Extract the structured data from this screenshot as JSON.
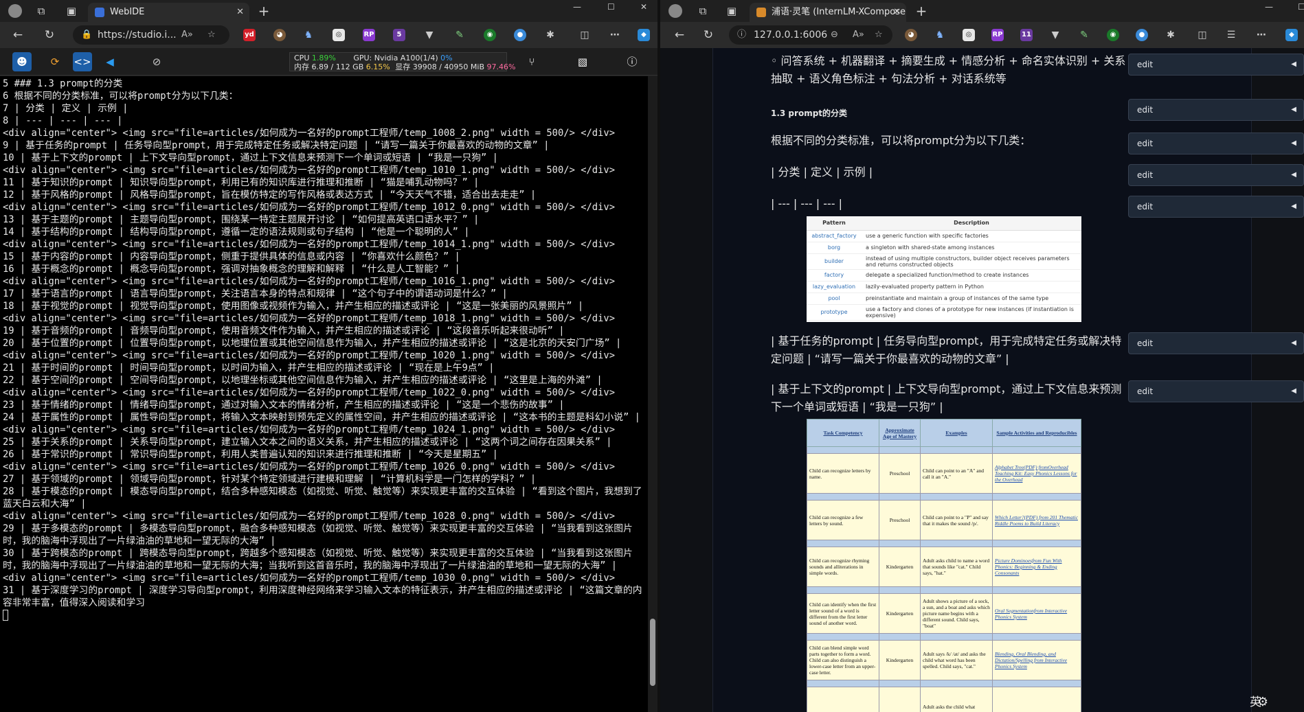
{
  "left_window": {
    "tab_title": "WebIDE",
    "url": "https://studio.i...",
    "window_controls": [
      "—",
      "☐",
      "✕"
    ],
    "stats": {
      "cpu_label": "CPU",
      "cpu_value": "1.89%",
      "mem_label": "内存 6.89 / 112 GB",
      "mem_value": "6.15%",
      "gpu_label": "GPU: Nvidia A100(1/4)",
      "gpu_value": "0%",
      "vram_label": "显存 39908 / 40950 MiB",
      "vram_value": "97.46%"
    },
    "ext_badge": "5",
    "terminal_lines": [
      "5 ### 1.3 prompt的分类",
      "6 根据不同的分类标准，可以将prompt分为以下几类：",
      "7 | 分类 | 定义 | 示例 |",
      "8 | --- | --- | --- |",
      "<div align=\"center\"> <img src=\"file=articles/如何成为一名好的prompt工程师/temp_1008_2.png\" width = 500/> </div>",
      "9 | 基于任务的prompt | 任务导向型prompt，用于完成特定任务或解决特定问题 | “请写一篇关于你最喜欢的动物的文章” |",
      "10 | 基于上下文的prompt | 上下文导向型prompt，通过上下文信息来预测下一个单词或短语 | “我是一只狗” |",
      "<div align=\"center\"> <img src=\"file=articles/如何成为一名好的prompt工程师/temp_1010_1.png\" width = 500/> </div>",
      "11 | 基于知识的prompt | 知识导向型prompt，利用已有的知识库进行推理和推断 | “猫是哺乳动物吗？” |",
      "12 | 基于风格的prompt | 风格导向型prompt，旨在模仿特定的写作风格或表达方式 | “今天天气不错，适合出去走走” |",
      "<div align=\"center\"> <img src=\"file=articles/如何成为一名好的prompt工程师/temp_1012_0.png\" width = 500/> </div>",
      "13 | 基于主题的prompt | 主题导向型prompt，围绕某一特定主题展开讨论 | “如何提高英语口语水平？” |",
      "14 | 基于结构的prompt | 结构导向型prompt，遵循一定的语法规则或句子结构 | “他是一个聪明的人” |",
      "<div align=\"center\"> <img src=\"file=articles/如何成为一名好的prompt工程师/temp_1014_1.png\" width = 500/> </div>",
      "15 | 基于内容的prompt | 内容导向型prompt，侧重于提供具体的信息或内容 | “你喜欢什么颜色？” |",
      "16 | 基于概念的prompt | 概念导向型prompt，强调对抽象概念的理解和解释 | “什么是人工智能？” |",
      "<div align=\"center\"> <img src=\"file=articles/如何成为一名好的prompt工程师/temp_1016_1.png\" width = 500/> </div>",
      "17 | 基于语言的prompt | 语言导向型prompt，关注语言本身的特点和规律 | “这个句子中的谓语动词是什么？” |",
      "18 | 基于视觉的prompt | 视觉导向型prompt，使用图像或视频作为输入，并产生相应的描述或评论 | “这是一张美丽的风景照片” |",
      "<div align=\"center\"> <img src=\"file=articles/如何成为一名好的prompt工程师/temp_1018_1.png\" width = 500/> </div>",
      "19 | 基于音频的prompt | 音频导向型prompt，使用音频文件作为输入，并产生相应的描述或评论 | “这段音乐听起来很动听” |",
      "20 | 基于位置的prompt | 位置导向型prompt，以地理位置或其他空间信息作为输入，并产生相应的描述或评论 | “这是北京的天安门广场” |",
      "<div align=\"center\"> <img src=\"file=articles/如何成为一名好的prompt工程师/temp_1020_1.png\" width = 500/> </div>",
      "21 | 基于时间的prompt | 时间导向型prompt，以时间为输入，并产生相应的描述或评论 | “现在是上午9点” |",
      "22 | 基于空间的prompt | 空间导向型prompt，以地理坐标或其他空间信息作为输入，并产生相应的描述或评论 | “这里是上海的外滩” |",
      "<div align=\"center\"> <img src=\"file=articles/如何成为一名好的prompt工程师/temp_1022_0.png\" width = 500/> </div>",
      "23 | 基于情绪的prompt | 情绪导向型prompt，通过对输入文本的情绪分析，产生相应的描述或评论 | “这是一个悲伤的故事” |",
      "24 | 基于属性的prompt | 属性导向型prompt，将输入文本映射到预先定义的属性空间，并产生相应的描述或评论 | “这本书的主题是科幻小说” |",
      "<div align=\"center\"> <img src=\"file=articles/如何成为一名好的prompt工程师/temp_1024_1.png\" width = 500/> </div>",
      "25 | 基于关系的prompt | 关系导向型prompt，建立输入文本之间的语义关系，并产生相应的描述或评论 | “这两个词之间存在因果关系” |",
      "26 | 基于常识的prompt | 常识导向型prompt，利用人类普遍认知的知识来进行推理和推断 | “今天是星期五” |",
      "<div align=\"center\"> <img src=\"file=articles/如何成为一名好的prompt工程师/temp_1026_0.png\" width = 500/> </div>",
      "27 | 基于领域的prompt | 领域导向型prompt，针对某个特定领域进行建模和理解 | “计算机科学是一门怎样的学科？” |",
      "28 | 基于模态的prompt | 模态导向型prompt，结合多种感知模态（如视觉、听觉、触觉等）来实现更丰富的交互体验 | “看到这个图片，我想到了蓝天白云和大海” |",
      "<div align=\"center\"> <img src=\"file=articles/如何成为一名好的prompt工程师/temp_1028_0.png\" width = 500/> </div>",
      "29 | 基于多模态的prompt | 多模态导向型prompt，融合多种感知模态（如视觉、听觉、触觉等）来实现更丰富的交互体验 | “当我看到这张图片时，我的脑海中浮现出了一片绿油油的草地和一望无际的大海” |",
      "30 | 基于跨模态的prompt | 跨模态导向型prompt，跨越多个感知模态（如视觉、听觉、触觉等）来实现更丰富的交互体验 | “当我看到这张图片时，我的脑海中浮现出了一片绿油油的草地和一望无际的大海；当我听到这首音乐时，我的脑海中浮现出了一片绿油油的草地和一望无际的大海” |",
      "<div align=\"center\"> <img src=\"file=articles/如何成为一名好的prompt工程师/temp_1030_0.png\" width = 500/> </div>",
      "31 | 基于深度学习的prompt | 深度学习导向型prompt，利用深度神经网络来学习输入文本的特征表示，并产生相应的描述或评论 | “这篇文章的内容非常丰富，值得深入阅读和学习"
    ]
  },
  "right_window": {
    "tab_title": "浦语·灵笔 (InternLM-XComposer)",
    "url": "127.0.0.1:6006",
    "ext_badge": "11",
    "blocks": [
      {
        "text": "◦   问答系统 + 机器翻译 + 摘要生成 + 情感分析 + 命名实体识别 + 关系抽取 + 语义角色标注 + 句法分析 + 对话系统等",
        "edit": "edit"
      },
      {
        "text": "1.3 prompt的分类",
        "edit": "edit"
      },
      {
        "text": "根据不同的分类标准，可以将prompt分为以下几类：",
        "edit": "edit"
      },
      {
        "text": "| 分类 | 定义 | 示例 |",
        "edit": "edit"
      },
      {
        "text": "| --- | --- | --- |",
        "edit": "edit"
      },
      {
        "text": "| 基于任务的prompt | 任务导向型prompt，用于完成特定任务或解决特定问题 | “请写一篇关于你最喜欢的动物的文章” |",
        "edit": "edit"
      },
      {
        "text": "| 基于上下文的prompt | 上下文导向型prompt，通过上下文信息来预测下一个单词或短语 | “我是一只狗” |",
        "edit": "edit"
      }
    ],
    "pattern_table": {
      "headers": [
        "Pattern",
        "Description"
      ],
      "rows": [
        [
          "abstract_factory",
          "use a generic function with specific factories"
        ],
        [
          "borg",
          "a singleton with shared-state among instances"
        ],
        [
          "builder",
          "instead of using multiple constructors, builder object receives parameters and returns constructed objects"
        ],
        [
          "factory",
          "delegate a specialized function/method to create instances"
        ],
        [
          "lazy_evaluation",
          "lazily-evaluated property pattern in Python"
        ],
        [
          "pool",
          "preinstantiate and maintain a group of instances of the same type"
        ],
        [
          "prototype",
          "use a factory and clones of a prototype for new instances (if instantiation is expensive)"
        ]
      ]
    },
    "competency_table": {
      "headers": [
        "Task Competency",
        "Approximate Age of Mastery",
        "Examples",
        "Sample Activities and Reproducibles"
      ],
      "rows": [
        [
          "Child can recognize letters by name.",
          "Preschool",
          "Child can point to an \"A\" and call it an \"A.\"",
          "Alphabet Tree(PDF) fromOverhead Teaching Kit: Easy Phonics Lessons for the Overhead"
        ],
        [
          "Child can recognize a few letters by sound.",
          "Preschool",
          "Child can point to a \"P\" and say that it makes the sound /p/.",
          "Which Letter?(PDF) from 201 Thematic Riddle Poems to Build Literacy"
        ],
        [
          "Child can recognize rhyming sounds and alliterations in simple words.",
          "Kindergarten",
          "Adult asks child to name a word that sounds like \"cat.\" Child says, \"hat.\"",
          "Picture Dominoesfrom Fun With Phonics: Beginning & Ending Consonants"
        ],
        [
          "Child can identify when the first letter sound of a word is different from the first letter sound of another word.",
          "Kindergarten",
          "Adult shows a picture of a sock, a sun, and a boat and asks which picture name begins with a different sound. Child says, \"boat\"",
          "Oral Segmentationfrom Interactive Phonics System"
        ],
        [
          "Child can blend simple word parts together to form a word. Child can also distinguish a lower-case letter from an upper-case letter.",
          "Kindergarten",
          "Adult says /k/ /at/ and asks the child what word has been spelled. Child says, \"cat.\"",
          "Blending, Oral Blending, and Dictation/Spelling from Interactive Phonics System"
        ],
        [
          "",
          "",
          "Adult asks the child what",
          ""
        ]
      ]
    },
    "ime": "英"
  }
}
